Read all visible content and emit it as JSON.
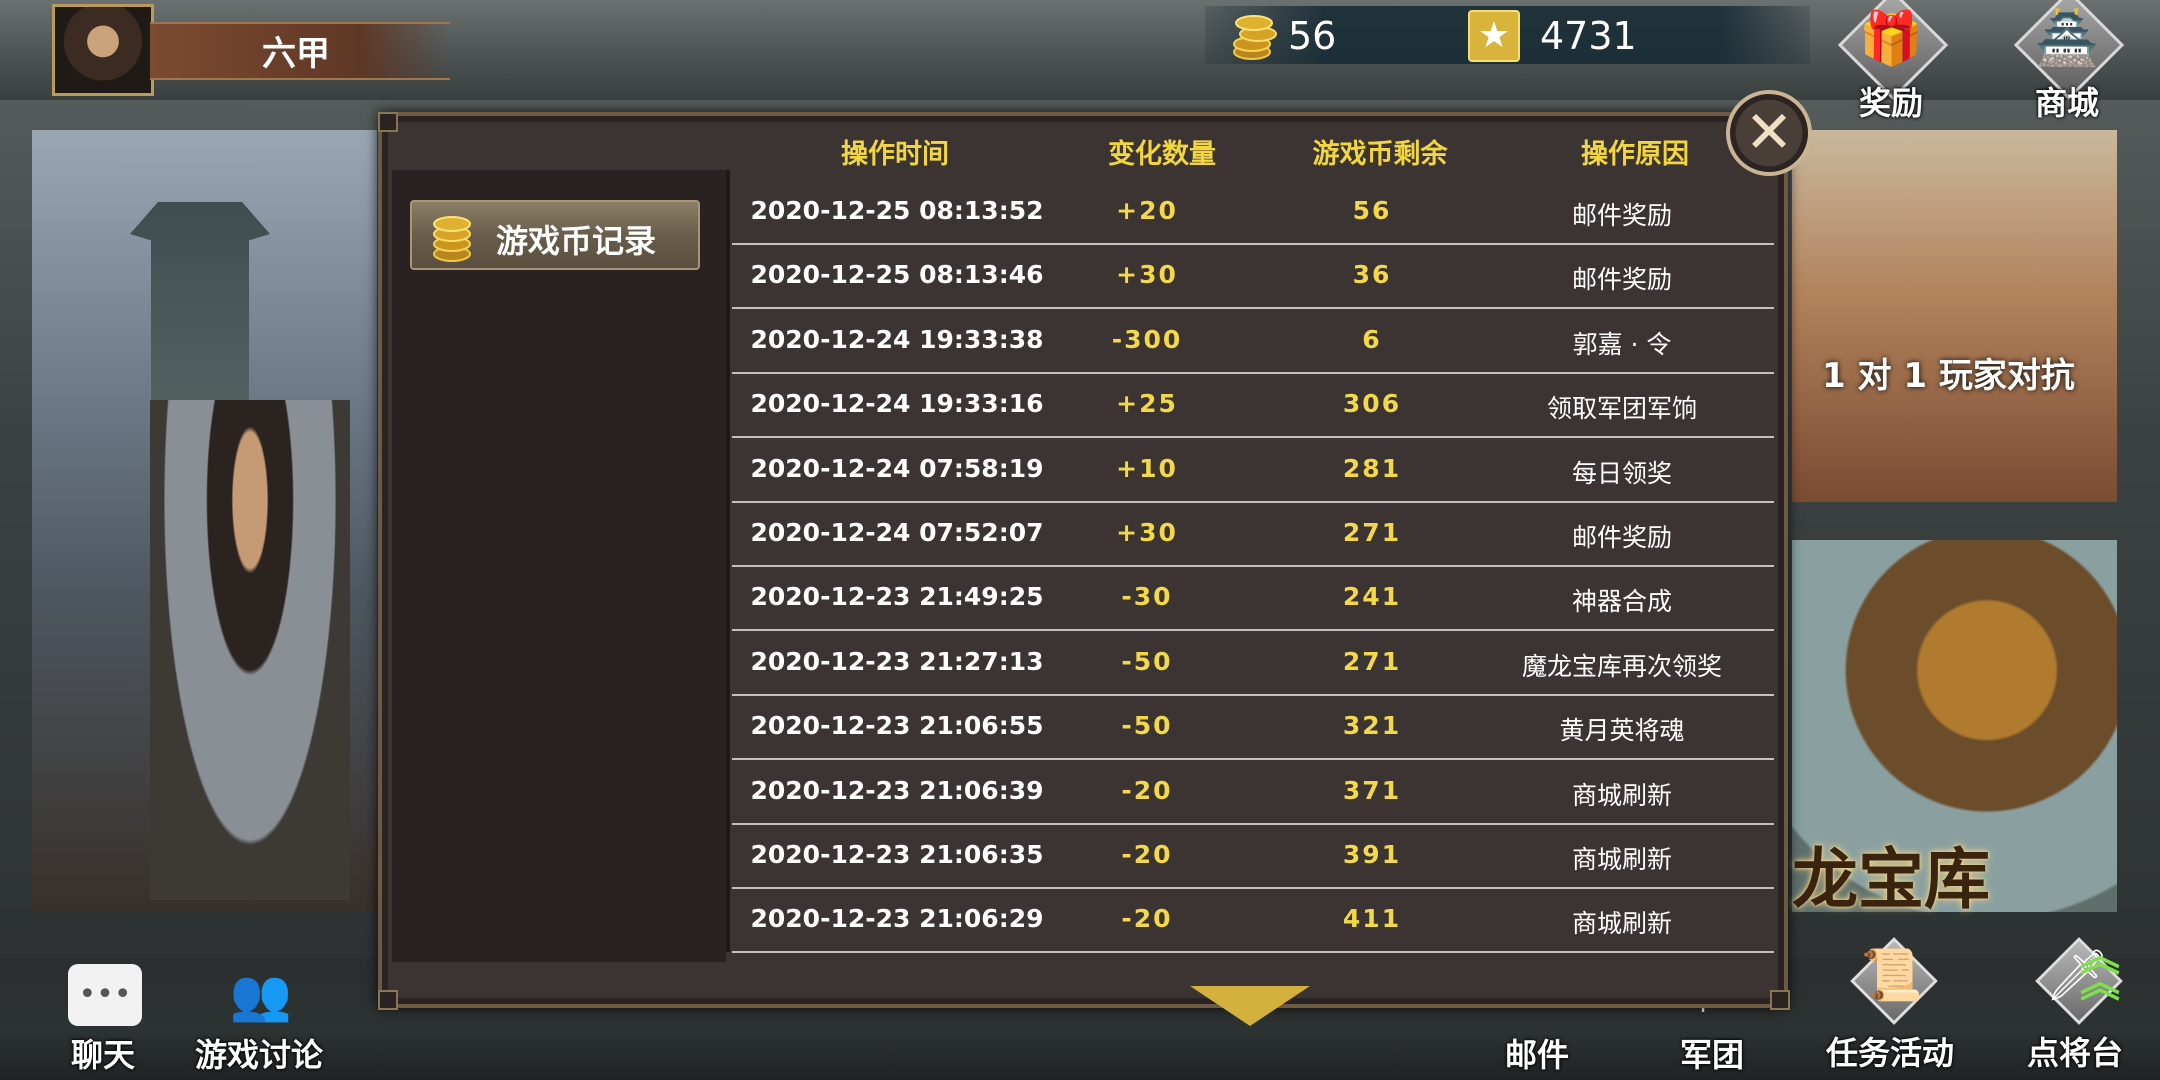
{
  "player": {
    "name": "六甲"
  },
  "resources": {
    "coins": "56",
    "stars": "4731"
  },
  "top_buttons": [
    {
      "label": "奖励",
      "icon": "gift-icon"
    },
    {
      "label": "商城",
      "icon": "shop-icon"
    }
  ],
  "banners": {
    "pvp": "1 对 1 玩家对抗",
    "treasury": "龙宝库"
  },
  "bottom_buttons": [
    {
      "label": "聊天",
      "icon": "chat-icon"
    },
    {
      "label": "游戏讨论",
      "icon": "discussion-icon"
    },
    {
      "label": "邮件",
      "icon": "mail-icon"
    },
    {
      "label": "军团",
      "icon": "legion-icon"
    },
    {
      "label": "任务活动",
      "icon": "scroll-icon"
    },
    {
      "label": "点将台",
      "icon": "sword-icon"
    }
  ],
  "dialog": {
    "tab_label": "游戏币记录",
    "columns": [
      "操作时间",
      "变化数量",
      "游戏币剩余",
      "操作原因"
    ],
    "rows": [
      {
        "time": "2020-12-25 08:13:52",
        "delta": "+20",
        "balance": "56",
        "reason": "邮件奖励"
      },
      {
        "time": "2020-12-25 08:13:46",
        "delta": "+30",
        "balance": "36",
        "reason": "邮件奖励"
      },
      {
        "time": "2020-12-24 19:33:38",
        "delta": "-300",
        "balance": "6",
        "reason": "郭嘉 · 令"
      },
      {
        "time": "2020-12-24 19:33:16",
        "delta": "+25",
        "balance": "306",
        "reason": "领取军团军饷"
      },
      {
        "time": "2020-12-24 07:58:19",
        "delta": "+10",
        "balance": "281",
        "reason": "每日领奖"
      },
      {
        "time": "2020-12-24 07:52:07",
        "delta": "+30",
        "balance": "271",
        "reason": "邮件奖励"
      },
      {
        "time": "2020-12-23 21:49:25",
        "delta": "-30",
        "balance": "241",
        "reason": "神器合成"
      },
      {
        "time": "2020-12-23 21:27:13",
        "delta": "-50",
        "balance": "271",
        "reason": "魔龙宝库再次领奖"
      },
      {
        "time": "2020-12-23 21:06:55",
        "delta": "-50",
        "balance": "321",
        "reason": "黄月英将魂"
      },
      {
        "time": "2020-12-23 21:06:39",
        "delta": "-20",
        "balance": "371",
        "reason": "商城刷新"
      },
      {
        "time": "2020-12-23 21:06:35",
        "delta": "-20",
        "balance": "391",
        "reason": "商城刷新"
      },
      {
        "time": "2020-12-23 21:06:29",
        "delta": "-20",
        "balance": "411",
        "reason": "商城刷新"
      }
    ]
  },
  "colors": {
    "accent_gold": "#f3d84a",
    "panel_bg": "#3c3433",
    "frame": "#6b5a44"
  }
}
